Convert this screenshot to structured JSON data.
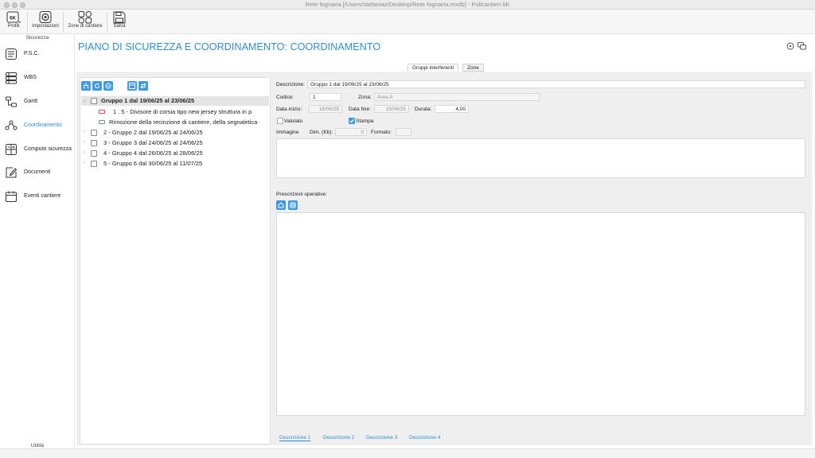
{
  "window": {
    "title": "Rete fognaria [/Users/stefaniaz/Desktop/Rete fognaria.mxdb] - Policantieri 6K"
  },
  "toolbar": {
    "profili_badge": "6K",
    "profili": "Profili",
    "impostazioni": "Impostazioni",
    "zone_cantiere": "Zone di cantiere",
    "salva": "Salva"
  },
  "sidebar": {
    "section_title": "Sicurezza",
    "items": [
      {
        "label": "P.S.C.",
        "icon": "document-list-icon"
      },
      {
        "label": "WBS",
        "icon": "wbs-icon"
      },
      {
        "label": "Gantt",
        "icon": "gantt-icon"
      },
      {
        "label": "Coordinamento",
        "icon": "coordination-icon",
        "active": true
      },
      {
        "label": "Computo sicurezza",
        "icon": "calculator-icon"
      },
      {
        "label": "Documenti",
        "icon": "edit-document-icon"
      },
      {
        "label": "Eventi cantiere",
        "icon": "calendar-icon"
      }
    ],
    "footer": "Utilità"
  },
  "page": {
    "title": "PIANO DI SICUREZZA E COORDINAMENTO: COORDINAMENTO"
  },
  "tabs": [
    {
      "label": "Gruppi interferenti",
      "active": true
    },
    {
      "label": "Zone",
      "active": false
    }
  ],
  "tree": {
    "rows": [
      {
        "text": "Gruppo   1 dal 19/06/25 al 23/06/25",
        "level": 0,
        "expanded": true,
        "selected": true
      },
      {
        "text": "1 .  5 - Divisore di corsia tipo new jersey struttura in p",
        "level": 1,
        "kind": "red"
      },
      {
        "text": "Rimozione della recinzione di cantiere, della segnaletica",
        "level": 1,
        "kind": "blue"
      },
      {
        "text": "2 - Gruppo   2 dal 19/06/25 al 24/06/25",
        "level": 0
      },
      {
        "text": "3 - Gruppo   3 dal 24/06/25 al 24/06/25",
        "level": 0
      },
      {
        "text": "4 - Gruppo   4 dal 26/06/25 al 28/06/25",
        "level": 0
      },
      {
        "text": "5 - Gruppo   6 dal 30/06/25 al 11/07/25",
        "level": 0
      }
    ]
  },
  "form": {
    "descrizione_label": "Descrizione:",
    "descrizione_value": "Gruppo   1 dal 19/06/25 al 23/06/25",
    "codice_label": "Codice:",
    "codice_value": "1",
    "zona_label": "Zona:",
    "zona_value": "Area A",
    "data_inizio_label": "Data inizio:",
    "data_inizio_value": "19/06/25",
    "data_fine_label": "Data fine:",
    "data_fine_value": "23/06/25",
    "durata_label": "Durata:",
    "durata_value": "4,00",
    "valutato_label": "Valutato",
    "stampa_label": "Stampa",
    "immagine_label": "Immagine",
    "dim_label": "Dim. (Kb):",
    "dim_value": "0",
    "formato_label": "Formato:",
    "formato_value": "",
    "prescrizioni_label": "Prescrizioni operative:"
  },
  "desc_tabs": [
    "Descrizione 1",
    "Descrizione 2",
    "Descrizione 3",
    "Descrizione 4"
  ],
  "colors": {
    "accent": "#2a8fd8",
    "button": "#3d9ae8"
  }
}
